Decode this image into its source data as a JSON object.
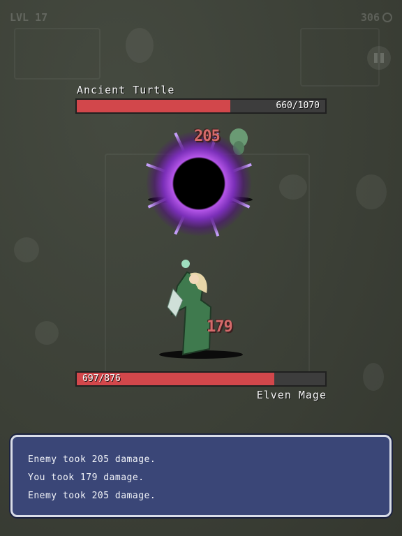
{
  "hud": {
    "level": "LVL 17",
    "coins": "306"
  },
  "enemy": {
    "name": "Ancient Turtle",
    "hp_text": "660/1070",
    "hp_fraction": 0.617,
    "damage_popup": "205"
  },
  "player": {
    "name": "Elven Mage",
    "hp_text": "697/876",
    "hp_fraction": 0.796,
    "damage_popup": "179"
  },
  "battle_log": [
    "Enemy took 205 damage.",
    "You took 179 damage.",
    "Enemy took 205 damage."
  ],
  "colors": {
    "hp_fill": "#d2474b",
    "log_bg": "#3a4677",
    "portal": "#b455e8"
  }
}
